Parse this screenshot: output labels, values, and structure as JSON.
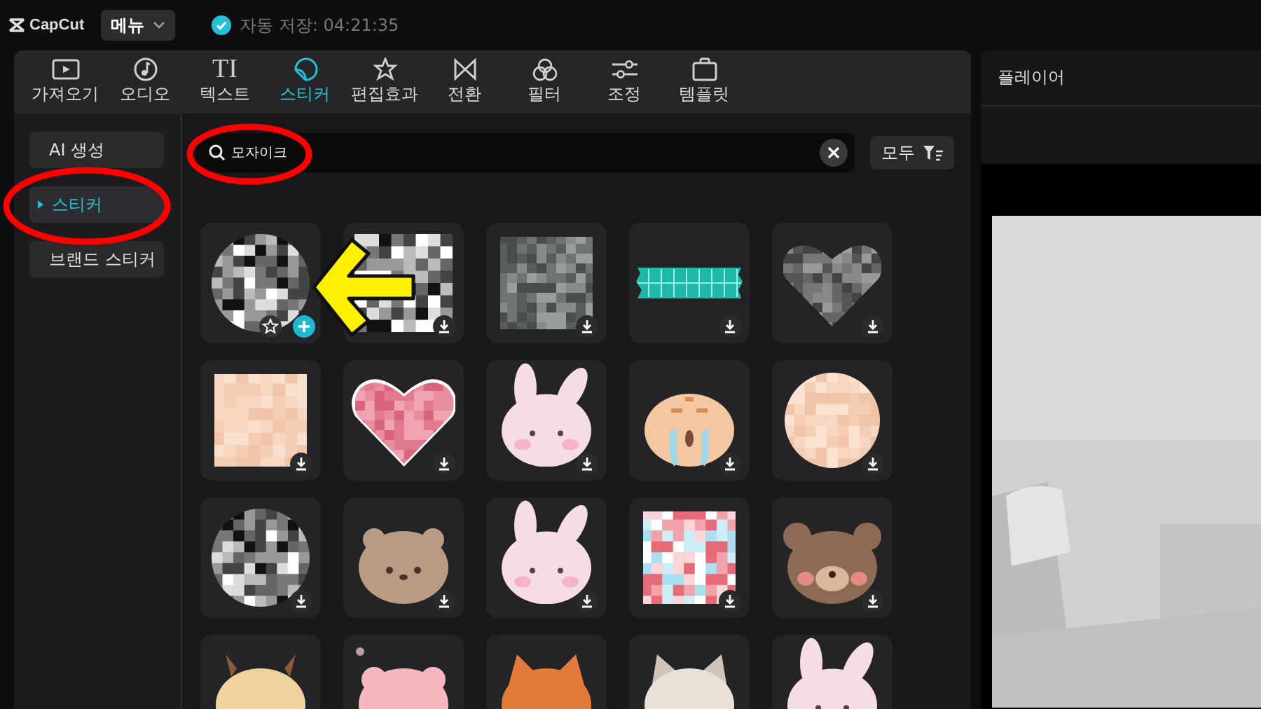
{
  "topbar": {
    "logo": "CapCut",
    "menu": "메뉴",
    "autosave": "자동 저장: 04:21:35"
  },
  "tabs": [
    {
      "label": "가져오기",
      "selected": false
    },
    {
      "label": "오디오",
      "selected": false
    },
    {
      "label": "텍스트",
      "icon_text": "TI",
      "selected": false
    },
    {
      "label": "스티커",
      "selected": true
    },
    {
      "label": "편집효과",
      "selected": false
    },
    {
      "label": "전환",
      "selected": false
    },
    {
      "label": "필터",
      "selected": false
    },
    {
      "label": "조정",
      "selected": false
    },
    {
      "label": "템플릿",
      "selected": false
    }
  ],
  "sidebar": {
    "items": [
      {
        "label": "AI 생성",
        "selected": false
      },
      {
        "label": "스티커",
        "selected": true
      },
      {
        "label": "브랜드 스티커",
        "selected": false
      }
    ]
  },
  "search": {
    "value": "모자이크",
    "filter": "모두"
  },
  "stickers": [
    {
      "kind": "mosaic-circle",
      "hovered": true
    },
    {
      "kind": "mosaic-square",
      "hovered": false
    },
    {
      "kind": "mosaic-gray",
      "hovered": false
    },
    {
      "kind": "tape",
      "hovered": false
    },
    {
      "kind": "mosaic-heart",
      "hovered": false
    },
    {
      "kind": "skin-square",
      "hovered": false
    },
    {
      "kind": "pink-heart",
      "hovered": false
    },
    {
      "kind": "bunny",
      "hovered": false
    },
    {
      "kind": "tiger",
      "hovered": false
    },
    {
      "kind": "skin-circle",
      "hovered": false
    },
    {
      "kind": "mosaic-circle",
      "hovered": false
    },
    {
      "kind": "fluffy-bear",
      "hovered": false
    },
    {
      "kind": "bunny",
      "hovered": false
    },
    {
      "kind": "color-mosaic",
      "hovered": false
    },
    {
      "kind": "bear",
      "hovered": false
    },
    {
      "kind": "cow"
    },
    {
      "kind": "pig"
    },
    {
      "kind": "red-panda"
    },
    {
      "kind": "cat"
    },
    {
      "kind": "bunny"
    }
  ],
  "player": {
    "title": "플레이어"
  },
  "annotations": [
    {
      "kind": "ring"
    },
    {
      "kind": "ring"
    },
    {
      "kind": "arrow"
    }
  ]
}
